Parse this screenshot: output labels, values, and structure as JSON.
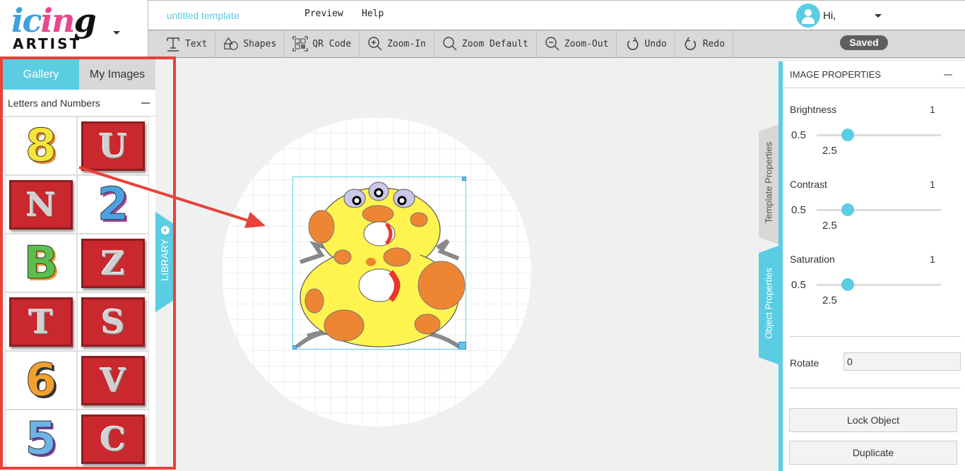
{
  "app": {
    "logo_top": "icing",
    "logo_bottom": "ARTIST",
    "document_title": "untitled template",
    "menu": [
      "Preview",
      "Help"
    ],
    "greeting": "Hi,",
    "save_status": "Saved"
  },
  "toolbar": {
    "items": [
      {
        "label": "Text",
        "icon": "text-icon"
      },
      {
        "label": "Shapes",
        "icon": "shapes-icon"
      },
      {
        "label": "QR Code",
        "icon": "qr-code-icon"
      },
      {
        "label": "Zoom-In",
        "icon": "zoom-in-icon"
      },
      {
        "label": "Zoom Default",
        "icon": "zoom-default-icon"
      },
      {
        "label": "Zoom-Out",
        "icon": "zoom-out-icon"
      },
      {
        "label": "Undo",
        "icon": "undo-icon"
      },
      {
        "label": "Redo",
        "icon": "redo-icon"
      }
    ]
  },
  "library": {
    "tabs": [
      "Gallery",
      "My Images"
    ],
    "active_tab": "Gallery",
    "category": "Letters and Numbers",
    "toggle_label": "LIBRARY",
    "items": [
      {
        "kind": "creature",
        "glyph": "8",
        "color": "#f5e53a",
        "accent": "#e8832f"
      },
      {
        "kind": "block",
        "glyph": "U"
      },
      {
        "kind": "block",
        "glyph": "N"
      },
      {
        "kind": "creature",
        "glyph": "2",
        "color": "#4aa3e0",
        "accent": "#a0439a"
      },
      {
        "kind": "creature",
        "glyph": "B",
        "color": "#5cbf4a",
        "accent": "#f29b2e"
      },
      {
        "kind": "block",
        "glyph": "Z"
      },
      {
        "kind": "block",
        "glyph": "T"
      },
      {
        "kind": "block",
        "glyph": "S"
      },
      {
        "kind": "creature",
        "glyph": "6",
        "color": "#f2a02e",
        "accent": "#333333"
      },
      {
        "kind": "block",
        "glyph": "V"
      },
      {
        "kind": "creature",
        "glyph": "5",
        "color": "#6cb5e8",
        "accent": "#7a3aa0"
      },
      {
        "kind": "block",
        "glyph": "C"
      }
    ]
  },
  "canvas": {
    "selected_object": "yellow number 8 monster"
  },
  "side_tabs": [
    "Template Properties",
    "Object Properties"
  ],
  "properties": {
    "header": "IMAGE PROPERTIES",
    "sliders": [
      {
        "name": "Brightness",
        "value": "1",
        "min": "0.5",
        "max": "2.5",
        "fraction": 0.25
      },
      {
        "name": "Contrast",
        "value": "1",
        "min": "0.5",
        "max": "2.5",
        "fraction": 0.25
      },
      {
        "name": "Saturation",
        "value": "1",
        "min": "0.5",
        "max": "2.5",
        "fraction": 0.25
      }
    ],
    "rotate_label": "Rotate",
    "rotate_value": "0",
    "lock_button": "Lock Object",
    "duplicate_button": "Duplicate"
  },
  "colors": {
    "accent": "#5bcde3",
    "annotation": "#e8423a",
    "saved_badge": "#5e5e5e"
  }
}
